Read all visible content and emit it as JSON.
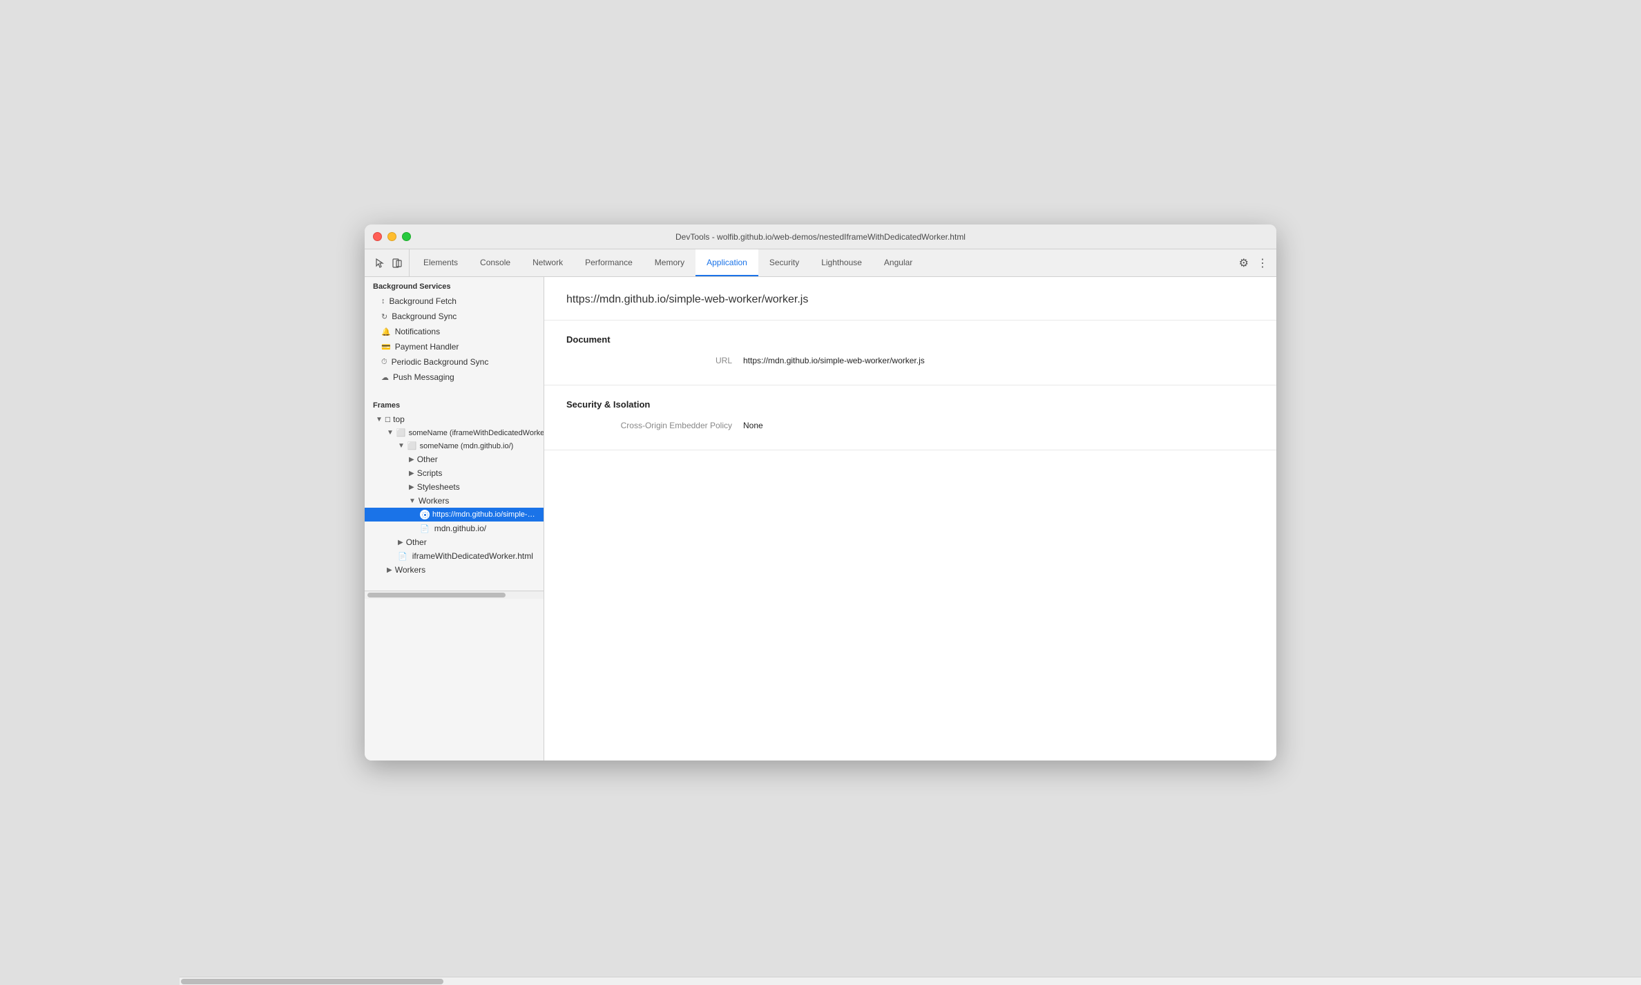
{
  "window": {
    "title": "DevTools - wolfib.github.io/web-demos/nestedIframeWithDedicatedWorker.html"
  },
  "devtools": {
    "tabs": [
      {
        "id": "elements",
        "label": "Elements",
        "active": false
      },
      {
        "id": "console",
        "label": "Console",
        "active": false
      },
      {
        "id": "network",
        "label": "Network",
        "active": false
      },
      {
        "id": "performance",
        "label": "Performance",
        "active": false
      },
      {
        "id": "memory",
        "label": "Memory",
        "active": false
      },
      {
        "id": "application",
        "label": "Application",
        "active": true
      },
      {
        "id": "security",
        "label": "Security",
        "active": false
      },
      {
        "id": "lighthouse",
        "label": "Lighthouse",
        "active": false
      },
      {
        "id": "angular",
        "label": "Angular",
        "active": false
      }
    ]
  },
  "sidebar": {
    "section_title": "Background Services",
    "items": [
      {
        "id": "bg-fetch",
        "label": "Background Fetch",
        "icon": "↕"
      },
      {
        "id": "bg-sync",
        "label": "Background Sync",
        "icon": "↻"
      },
      {
        "id": "notifications",
        "label": "Notifications",
        "icon": "🔔"
      },
      {
        "id": "payment-handler",
        "label": "Payment Handler",
        "icon": "🃏"
      },
      {
        "id": "periodic-bg-sync",
        "label": "Periodic Background Sync",
        "icon": "⏱"
      },
      {
        "id": "push-messaging",
        "label": "Push Messaging",
        "icon": "☁"
      }
    ],
    "frames_title": "Frames",
    "tree": [
      {
        "id": "top",
        "label": "top",
        "indent": 0,
        "type": "folder",
        "expanded": true,
        "icon": "▼"
      },
      {
        "id": "someName-iframe",
        "label": "someName (iframeWithDedicatedWorker.html)",
        "indent": 1,
        "type": "iframe",
        "expanded": true,
        "icon": "▼"
      },
      {
        "id": "someName-mdn",
        "label": "someName (mdn.github.io/)",
        "indent": 2,
        "type": "iframe",
        "expanded": true,
        "icon": "▼"
      },
      {
        "id": "other-1",
        "label": "Other",
        "indent": 3,
        "type": "folder",
        "expanded": false,
        "icon": "▶"
      },
      {
        "id": "scripts",
        "label": "Scripts",
        "indent": 3,
        "type": "folder",
        "expanded": false,
        "icon": "▶"
      },
      {
        "id": "stylesheets",
        "label": "Stylesheets",
        "indent": 3,
        "type": "folder",
        "expanded": false,
        "icon": "▶"
      },
      {
        "id": "workers",
        "label": "Workers",
        "indent": 3,
        "type": "folder",
        "expanded": true,
        "icon": "▼"
      },
      {
        "id": "worker-url",
        "label": "https://mdn.github.io/simple-web-worker",
        "indent": 4,
        "type": "worker",
        "selected": true
      },
      {
        "id": "mdn-github",
        "label": "mdn.github.io/",
        "indent": 4,
        "type": "file"
      },
      {
        "id": "other-2",
        "label": "Other",
        "indent": 2,
        "type": "folder",
        "expanded": false,
        "icon": "▶"
      },
      {
        "id": "iframe-file",
        "label": "iframeWithDedicatedWorker.html",
        "indent": 2,
        "type": "file"
      },
      {
        "id": "workers-2",
        "label": "Workers",
        "indent": 1,
        "type": "folder",
        "expanded": false,
        "icon": "▶"
      }
    ]
  },
  "main": {
    "url": "https://mdn.github.io/simple-web-worker/worker.js",
    "sections": [
      {
        "id": "document",
        "title": "Document",
        "rows": [
          {
            "label": "URL",
            "value": "https://mdn.github.io/simple-web-worker/worker.js"
          }
        ]
      },
      {
        "id": "security-isolation",
        "title": "Security & Isolation",
        "rows": [
          {
            "label": "Cross-Origin Embedder Policy",
            "value": "None"
          }
        ]
      }
    ]
  }
}
